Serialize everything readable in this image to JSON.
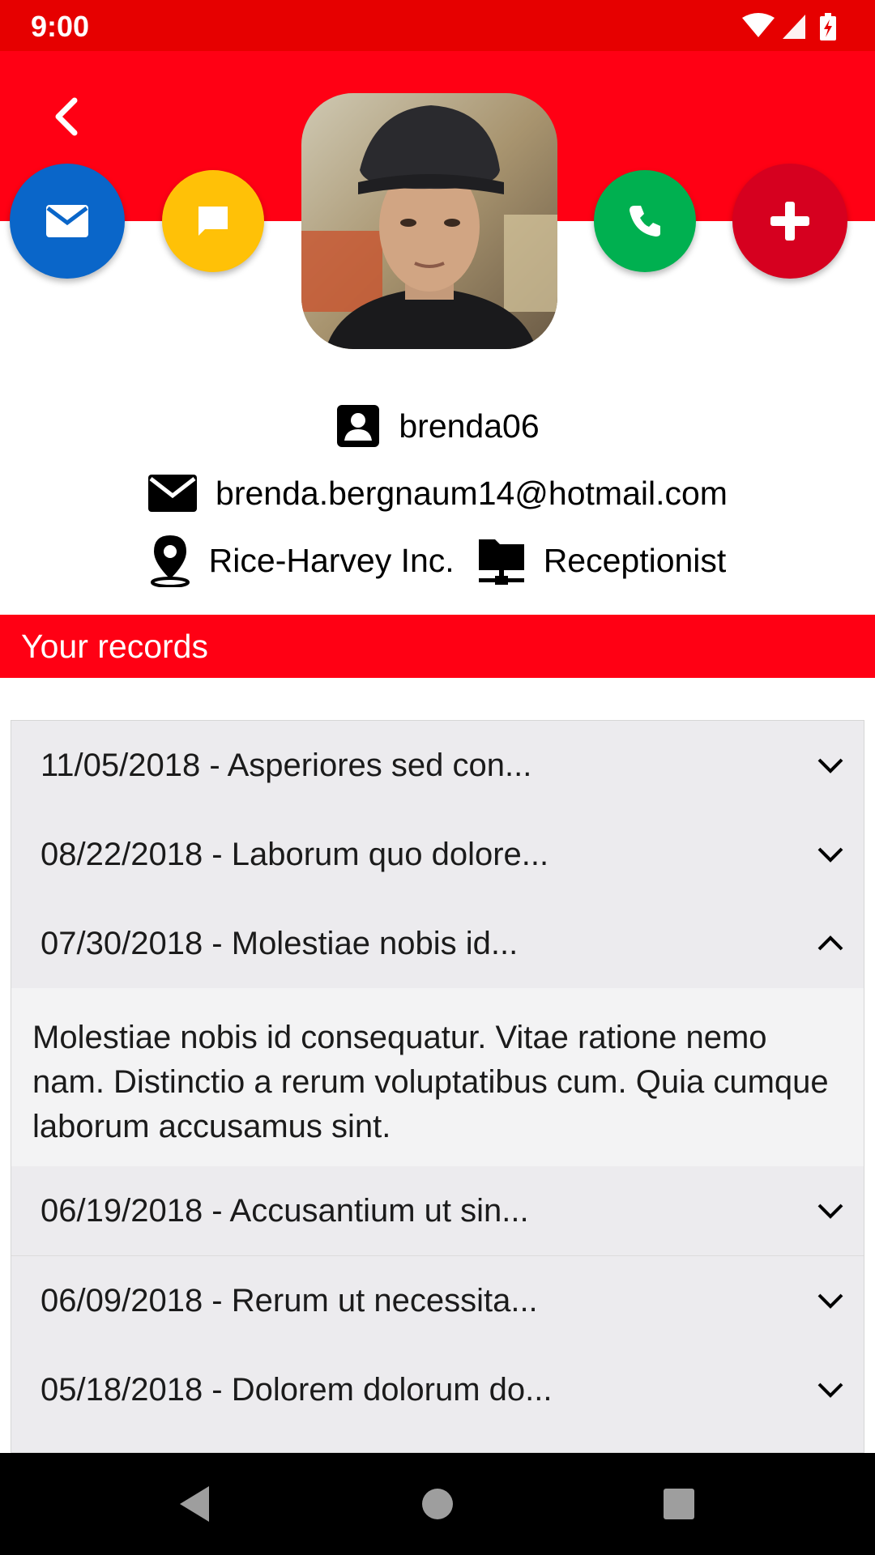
{
  "status_bar": {
    "time": "9:00",
    "icons": [
      "wifi-icon",
      "signal-icon",
      "battery-charging-icon"
    ]
  },
  "header": {
    "back_icon": "chevron-left-icon",
    "actions": [
      {
        "name": "email",
        "icon": "mail-icon",
        "color": "#0a66c9"
      },
      {
        "name": "message",
        "icon": "chat-icon",
        "color": "#ffc107"
      },
      {
        "name": "call",
        "icon": "phone-icon",
        "color": "#00b050"
      },
      {
        "name": "add",
        "icon": "plus-icon",
        "color": "#d6001f"
      }
    ],
    "accent_color": "#ff0014",
    "status_color": "#e60000"
  },
  "profile": {
    "username": "brenda06",
    "email": "brenda.bergnaum14@hotmail.com",
    "company": "Rice-Harvey Inc.",
    "role": "Receptionist"
  },
  "records": {
    "title": "Your records",
    "items": [
      {
        "title": "11/05/2018 - Asperiores sed con...",
        "expanded": false
      },
      {
        "title": "08/22/2018 - Laborum quo dolore...",
        "expanded": false
      },
      {
        "title": "07/30/2018 - Molestiae nobis id...",
        "expanded": true,
        "detail": "Molestiae nobis id consequatur. Vitae ratione nemo nam. Distinctio a rerum voluptatibus cum. Quia cumque laborum accusamus sint."
      },
      {
        "title": "06/19/2018 - Accusantium ut sin...",
        "expanded": false
      },
      {
        "title": "06/09/2018 - Rerum ut necessita...",
        "expanded": false
      },
      {
        "title": "05/18/2018 - Dolorem dolorum do...",
        "expanded": false
      }
    ]
  },
  "nav_bar": {
    "buttons": [
      "back-triangle-icon",
      "home-circle-icon",
      "recents-square-icon"
    ]
  }
}
